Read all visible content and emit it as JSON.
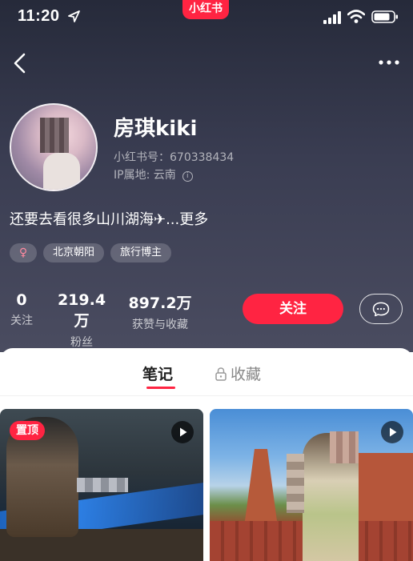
{
  "status_bar": {
    "time": "11:20",
    "app_badge": "小红书"
  },
  "profile": {
    "nickname": "房琪kiki",
    "red_id": "小红书号：670338434",
    "ip_location": "IP属地: 云南",
    "bio": "还要去看很多山川湖海✈...更多",
    "tags": [
      "♀",
      "北京朝阳",
      "旅行博主"
    ]
  },
  "stats": [
    {
      "value": "0",
      "label": "关注"
    },
    {
      "value": "219.4万",
      "label": "粉丝"
    },
    {
      "value": "897.2万",
      "label": "获赞与收藏"
    }
  ],
  "actions": {
    "follow_label": "关注"
  },
  "tabs": {
    "notes_label": "笔记",
    "collect_label": "收藏"
  },
  "notes": {
    "pinned_label": "置顶"
  },
  "colors": {
    "brand_red": "#ff2442",
    "header_bg": "#2c2f42"
  },
  "icons": [
    "location-arrow-icon",
    "signal-icon",
    "wifi-icon",
    "battery-icon",
    "back-arrow-icon",
    "more-dots-icon",
    "info-icon",
    "message-icon",
    "lock-icon",
    "play-icon"
  ]
}
